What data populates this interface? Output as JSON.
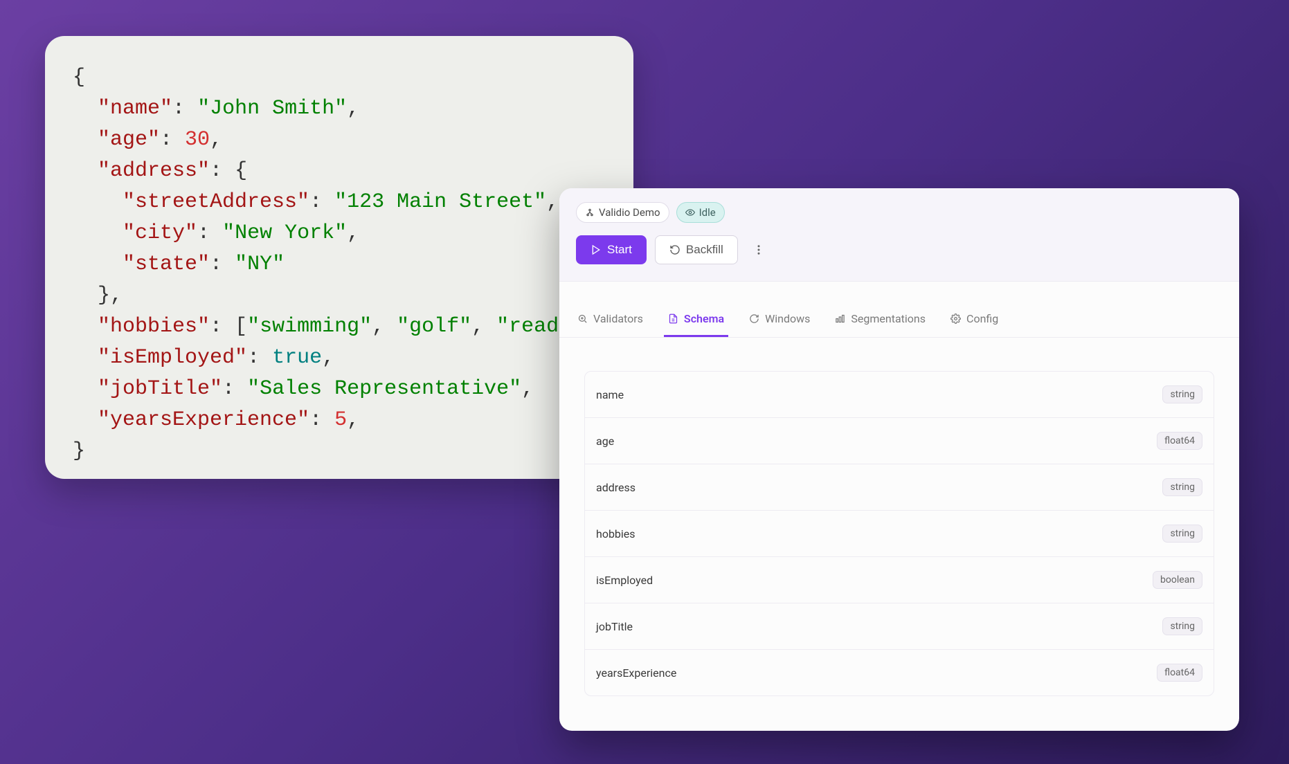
{
  "code": {
    "name": {
      "key": "\"name\"",
      "val": "\"John Smith\""
    },
    "age": {
      "key": "\"age\"",
      "val": "30"
    },
    "address": {
      "key": "\"address\""
    },
    "streetAddress": {
      "key": "\"streetAddress\"",
      "val": "\"123 Main Street\""
    },
    "city": {
      "key": "\"city\"",
      "val": "\"New York\""
    },
    "state": {
      "key": "\"state\"",
      "val": "\"NY\""
    },
    "hobbies": {
      "key": "\"hobbies\"",
      "v1": "\"swimming\"",
      "v2": "\"golf\"",
      "v3": "\"reading"
    },
    "isEmployed": {
      "key": "\"isEmployed\"",
      "val": "true"
    },
    "jobTitle": {
      "key": "\"jobTitle\"",
      "val": "\"Sales Representative\""
    },
    "yearsExperience": {
      "key": "\"yearsExperience\"",
      "val": "5"
    },
    "punc": {
      "obr": "{",
      "cbr": "}",
      "colon": ": ",
      "comma": ",",
      "comma_sp": ", ",
      "osq": "[",
      "cbr_comma": "},"
    }
  },
  "header": {
    "demo_label": "Validio Demo",
    "status_label": "Idle",
    "start_label": "Start",
    "backfill_label": "Backfill"
  },
  "tabs": {
    "validators": "Validators",
    "schema": "Schema",
    "windows": "Windows",
    "segmentations": "Segmentations",
    "config": "Config"
  },
  "schema": {
    "rows": [
      {
        "name": "name",
        "type": "string"
      },
      {
        "name": "age",
        "type": "float64"
      },
      {
        "name": "address",
        "type": "string"
      },
      {
        "name": "hobbies",
        "type": "string"
      },
      {
        "name": "isEmployed",
        "type": "boolean"
      },
      {
        "name": "jobTitle",
        "type": "string"
      },
      {
        "name": "yearsExperience",
        "type": "float64"
      }
    ]
  }
}
